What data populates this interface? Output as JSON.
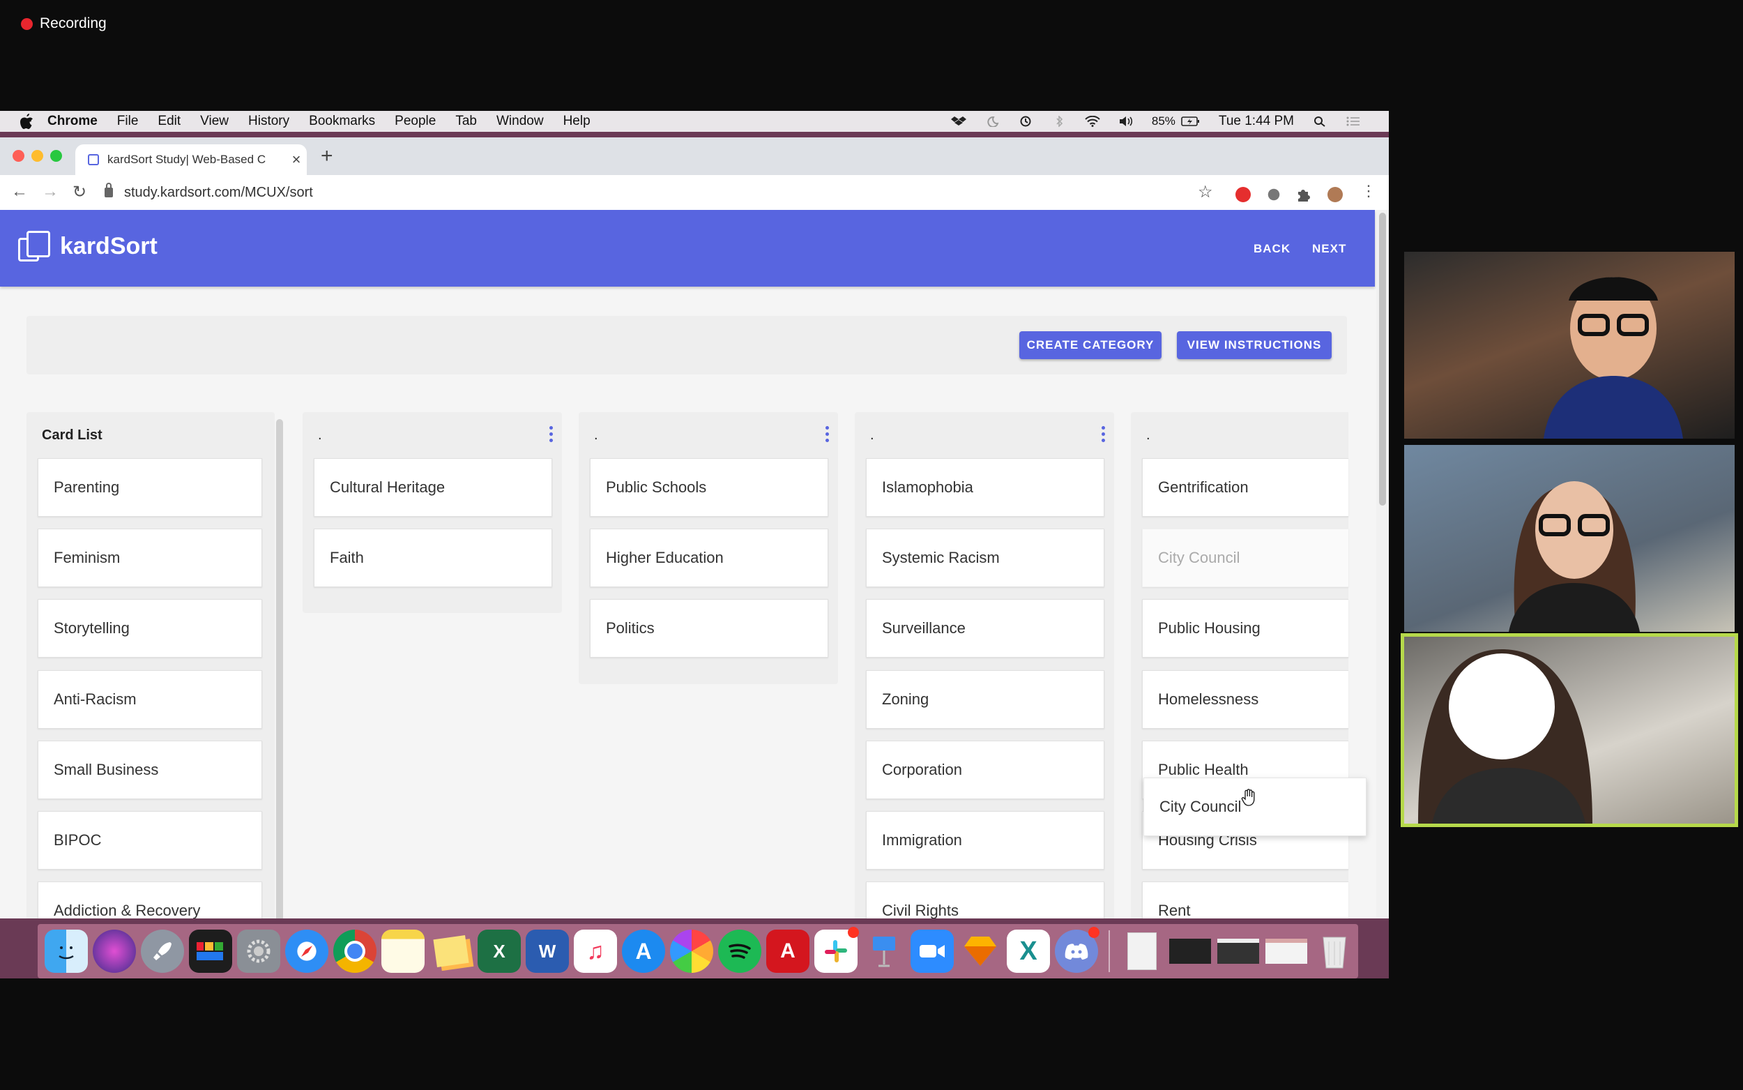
{
  "recording": {
    "label": "Recording"
  },
  "menubar": {
    "app": "Chrome",
    "items": [
      "File",
      "Edit",
      "View",
      "History",
      "Bookmarks",
      "People",
      "Tab",
      "Window",
      "Help"
    ],
    "battery": "85%",
    "clock": "Tue 1:44 PM"
  },
  "browser": {
    "tab_title": "kardSort Study| Web-Based C",
    "url": "study.kardsort.com/MCUX/sort"
  },
  "app": {
    "brand": "kardSort",
    "back_label": "BACK",
    "next_label": "NEXT",
    "create_category_label": "CREATE CATEGORY",
    "view_instructions_label": "VIEW INSTRUCTIONS",
    "accent": "#5865e0"
  },
  "card_list": {
    "title": "Card List",
    "cards": [
      "Parenting",
      "Feminism",
      "Storytelling",
      "Anti-Racism",
      "Small Business",
      "BIPOC",
      "Addiction & Recovery"
    ]
  },
  "categories": [
    {
      "name": ".",
      "cards": [
        "Cultural Heritage",
        "Faith"
      ]
    },
    {
      "name": ".",
      "cards": [
        "Public Schools",
        "Higher Education",
        "Politics"
      ]
    },
    {
      "name": ".",
      "cards": [
        "Islamophobia",
        "Systemic Racism",
        "Surveillance",
        "Zoning",
        "Corporation",
        "Immigration",
        "Civil Rights"
      ]
    },
    {
      "name": ".",
      "cards": [
        "Gentrification",
        "City Council",
        "Public Housing",
        "Homelessness",
        "Public Health",
        "Housing Crisis",
        "Rent"
      ]
    }
  ],
  "dragging_card": "City Council",
  "dock": {
    "icons": [
      "finder-icon",
      "siri-icon",
      "launchpad-icon",
      "activity-monitor-icon",
      "system-preferences-icon",
      "safari-icon",
      "chrome-icon",
      "notes-icon",
      "stickies-icon",
      "excel-icon",
      "word-icon",
      "music-icon",
      "app-store-icon",
      "photos-icon",
      "spotify-icon",
      "acrobat-icon",
      "slack-icon",
      "keynote-icon",
      "zoom-icon",
      "sketch-icon",
      "xmind-icon",
      "discord-icon",
      "document-icon",
      "window-thumbnail-icon",
      "window-thumbnail-icon",
      "window-thumbnail-icon",
      "trash-icon"
    ]
  }
}
